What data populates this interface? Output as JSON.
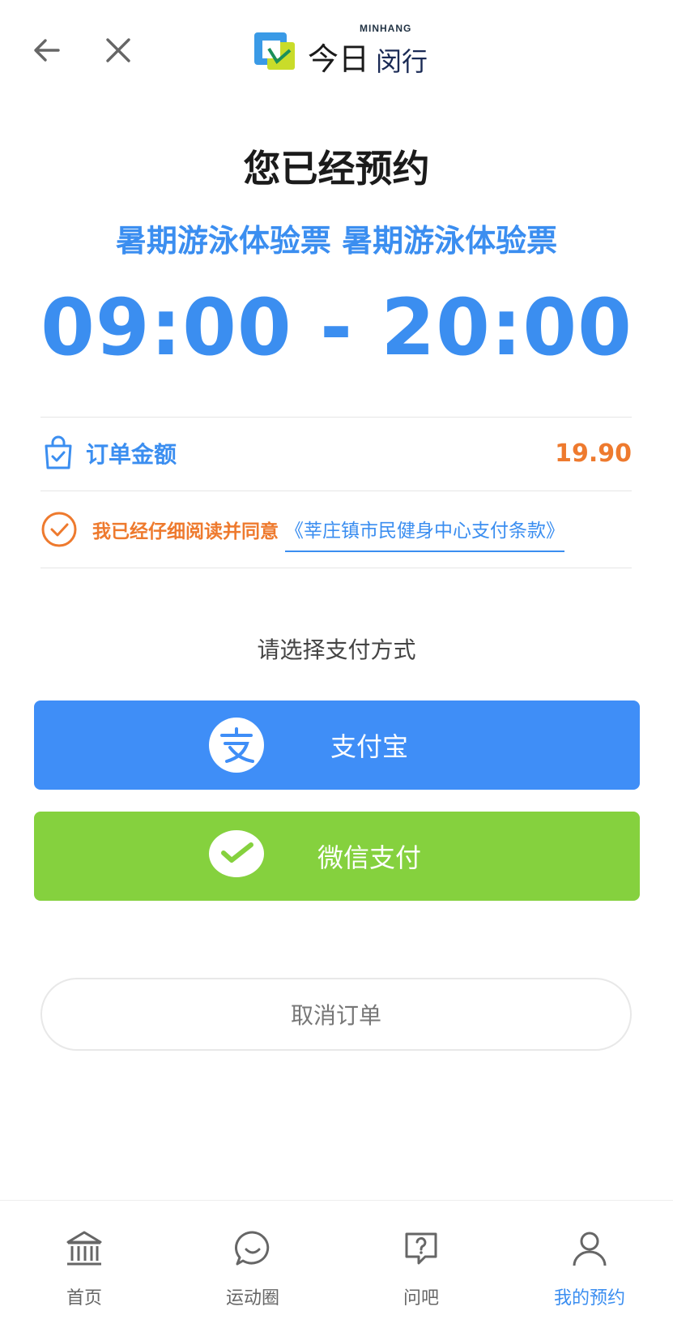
{
  "header": {
    "back_icon": "arrow-left-icon",
    "close_icon": "close-icon",
    "logo_en": "MINHANG",
    "logo_cn_1": "今日",
    "logo_cn_2": "闵行"
  },
  "booking": {
    "title": "您已经预约",
    "ticket_name": "暑期游泳体验票 暑期游泳体验票",
    "time_range": "09:00 - 20:00"
  },
  "order": {
    "label": "订单金额",
    "amount": "19.90",
    "icon": "shopping-bag-check-icon"
  },
  "agreement": {
    "text": "我已经仔细阅读并同意",
    "link": "《莘庄镇市民健身中心支付条款》",
    "icon": "check-circle-icon"
  },
  "payment": {
    "prompt": "请选择支付方式",
    "alipay_label": "支付宝",
    "wechat_label": "微信支付",
    "alipay_color": "#3f8ef7",
    "wechat_color": "#85d13e"
  },
  "cancel_label": "取消订单",
  "tabbar": {
    "items": [
      {
        "label": "首页",
        "icon": "home-bank-icon"
      },
      {
        "label": "运动圈",
        "icon": "chat-circle-icon"
      },
      {
        "label": "问吧",
        "icon": "question-bubble-icon"
      },
      {
        "label": "我的预约",
        "icon": "user-icon"
      }
    ],
    "active_index": 3
  },
  "colors": {
    "accent": "#3b8ef0",
    "orange": "#ee7a2e"
  }
}
